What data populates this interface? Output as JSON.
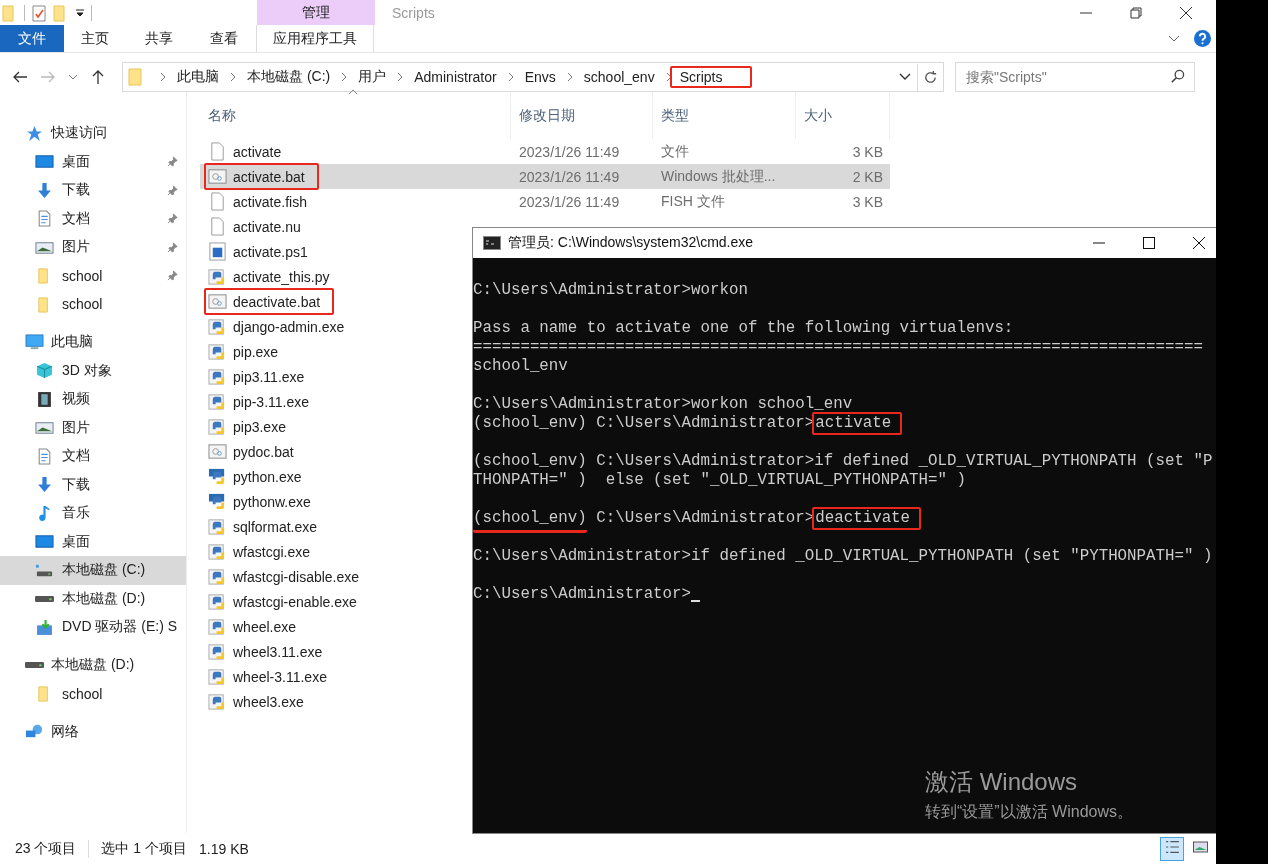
{
  "window": {
    "title": "Scripts"
  },
  "ribbon": {
    "context_group": "管理",
    "tabs": [
      {
        "label": "文件",
        "kind": "file"
      },
      {
        "label": "主页",
        "kind": "tab"
      },
      {
        "label": "共享",
        "kind": "tab"
      },
      {
        "label": "查看",
        "kind": "tab"
      },
      {
        "label": "应用程序工具",
        "kind": "context"
      }
    ]
  },
  "address_bar": {
    "crumbs": [
      {
        "label": "此电脑",
        "highlighted": false
      },
      {
        "label": "本地磁盘 (C:)",
        "highlighted": false
      },
      {
        "label": "用户",
        "highlighted": false
      },
      {
        "label": "Administrator",
        "highlighted": false
      },
      {
        "label": "Envs",
        "highlighted": false
      },
      {
        "label": "school_env",
        "highlighted": false
      },
      {
        "label": "Scripts",
        "highlighted": true
      }
    ]
  },
  "search": {
    "placeholder": "搜索\"Scripts\""
  },
  "sidebar": {
    "items": [
      {
        "label": "快速访问",
        "kind": "star",
        "selected": false,
        "children": [
          {
            "label": "桌面",
            "kind": "desktop",
            "pinned": true,
            "selected": false
          },
          {
            "label": "下载",
            "kind": "download",
            "pinned": true,
            "selected": false
          },
          {
            "label": "文档",
            "kind": "document",
            "pinned": true,
            "selected": false
          },
          {
            "label": "图片",
            "kind": "picture",
            "pinned": true,
            "selected": false
          },
          {
            "label": "school",
            "kind": "folder",
            "pinned": true,
            "selected": false
          },
          {
            "label": "school",
            "kind": "folder",
            "pinned": false,
            "selected": false
          }
        ]
      },
      {
        "label": "此电脑",
        "kind": "pc",
        "selected": false,
        "children": [
          {
            "label": "3D 对象",
            "kind": "cube",
            "pinned": false,
            "selected": false
          },
          {
            "label": "视频",
            "kind": "video",
            "pinned": false,
            "selected": false
          },
          {
            "label": "图片",
            "kind": "picture",
            "pinned": false,
            "selected": false
          },
          {
            "label": "文档",
            "kind": "document",
            "pinned": false,
            "selected": false
          },
          {
            "label": "下载",
            "kind": "download",
            "pinned": false,
            "selected": false
          },
          {
            "label": "音乐",
            "kind": "music",
            "pinned": false,
            "selected": false
          },
          {
            "label": "桌面",
            "kind": "desktop",
            "pinned": false,
            "selected": false
          },
          {
            "label": "本地磁盘 (C:)",
            "kind": "system-drive",
            "pinned": false,
            "selected": true
          },
          {
            "label": "本地磁盘 (D:)",
            "kind": "drive",
            "pinned": false,
            "selected": false
          },
          {
            "label": "DVD 驱动器 (E:) S",
            "kind": "dvd",
            "pinned": false,
            "selected": false
          }
        ]
      },
      {
        "label": "本地磁盘 (D:)",
        "kind": "drive",
        "selected": false,
        "children": [
          {
            "label": "school",
            "kind": "folder",
            "pinned": false,
            "selected": false
          }
        ]
      },
      {
        "label": "网络",
        "kind": "network",
        "selected": false
      }
    ]
  },
  "table": {
    "columns": [
      {
        "label": "名称",
        "sorted": true
      },
      {
        "label": "修改日期",
        "sorted": false
      },
      {
        "label": "类型",
        "sorted": false
      },
      {
        "label": "大小",
        "sorted": false
      }
    ],
    "rows": [
      {
        "name": "activate",
        "kind": "blank",
        "selected": false,
        "highlighted": false,
        "date": "2023/1/26 11:49",
        "type": "文件",
        "size": "3 KB"
      },
      {
        "name": "activate.bat",
        "kind": "bat",
        "selected": true,
        "highlighted": true,
        "date": "2023/1/26 11:49",
        "type": "Windows 批处理...",
        "size": "2 KB"
      },
      {
        "name": "activate.fish",
        "kind": "blank",
        "selected": false,
        "highlighted": false,
        "date": "2023/1/26 11:49",
        "type": "FISH 文件",
        "size": "3 KB"
      },
      {
        "name": "activate.nu",
        "kind": "blank",
        "selected": false,
        "highlighted": false
      },
      {
        "name": "activate.ps1",
        "kind": "ps1",
        "selected": false,
        "highlighted": false
      },
      {
        "name": "activate_this.py",
        "kind": "py",
        "selected": false,
        "highlighted": false
      },
      {
        "name": "deactivate.bat",
        "kind": "bat",
        "selected": false,
        "highlighted": true
      },
      {
        "name": "django-admin.exe",
        "kind": "exe",
        "selected": false,
        "highlighted": false
      },
      {
        "name": "pip.exe",
        "kind": "exe",
        "selected": false,
        "highlighted": false
      },
      {
        "name": "pip3.11.exe",
        "kind": "exe",
        "selected": false,
        "highlighted": false
      },
      {
        "name": "pip-3.11.exe",
        "kind": "exe",
        "selected": false,
        "highlighted": false
      },
      {
        "name": "pip3.exe",
        "kind": "exe",
        "selected": false,
        "highlighted": false
      },
      {
        "name": "pydoc.bat",
        "kind": "bat",
        "selected": false,
        "highlighted": false
      },
      {
        "name": "python.exe",
        "kind": "app",
        "selected": false,
        "highlighted": false
      },
      {
        "name": "pythonw.exe",
        "kind": "app",
        "selected": false,
        "highlighted": false
      },
      {
        "name": "sqlformat.exe",
        "kind": "exe",
        "selected": false,
        "highlighted": false
      },
      {
        "name": "wfastcgi.exe",
        "kind": "exe",
        "selected": false,
        "highlighted": false
      },
      {
        "name": "wfastcgi-disable.exe",
        "kind": "exe",
        "selected": false,
        "highlighted": false
      },
      {
        "name": "wfastcgi-enable.exe",
        "kind": "exe",
        "selected": false,
        "highlighted": false
      },
      {
        "name": "wheel.exe",
        "kind": "exe",
        "selected": false,
        "highlighted": false
      },
      {
        "name": "wheel3.11.exe",
        "kind": "exe",
        "selected": false,
        "highlighted": false
      },
      {
        "name": "wheel-3.11.exe",
        "kind": "exe",
        "selected": false,
        "highlighted": false
      },
      {
        "name": "wheel3.exe",
        "kind": "exe",
        "selected": false,
        "highlighted": false
      }
    ]
  },
  "terminal": {
    "title": "管理员: C:\\Windows\\system32\\cmd.exe",
    "lines": [
      {
        "kind": "text",
        "segments": [
          {
            "text": "C:\\Users\\Administrator>workon",
            "kind": "plain"
          }
        ]
      },
      {
        "kind": "blank"
      },
      {
        "kind": "text",
        "segments": [
          {
            "text": "Pass a name to activate one of the following virtualenvs:",
            "kind": "plain"
          }
        ]
      },
      {
        "kind": "text",
        "segments": [
          {
            "text": "=============================================================================",
            "kind": "plain"
          }
        ]
      },
      {
        "kind": "text",
        "segments": [
          {
            "text": "school_env",
            "kind": "plain"
          }
        ]
      },
      {
        "kind": "blank"
      },
      {
        "kind": "text",
        "segments": [
          {
            "text": "C:\\Users\\Administrator>workon school_env",
            "kind": "plain"
          }
        ]
      },
      {
        "kind": "text",
        "segments": [
          {
            "text": "(school_env) C:\\Users\\Administrator>",
            "kind": "plain"
          },
          {
            "text": "activate",
            "kind": "boxed"
          }
        ]
      },
      {
        "kind": "blank"
      },
      {
        "kind": "text",
        "segments": [
          {
            "text": "(school_env) C:\\Users\\Administrator>if defined _OLD_VIRTUAL_PYTHONPATH (set \"P",
            "kind": "plain"
          }
        ]
      },
      {
        "kind": "text",
        "segments": [
          {
            "text": "THONPATH=\" )  else (set \"_OLD_VIRTUAL_PYTHONPATH=\" )",
            "kind": "plain"
          }
        ]
      },
      {
        "kind": "blank"
      },
      {
        "kind": "text",
        "segments": [
          {
            "text": "(school_env)",
            "kind": "underlined"
          },
          {
            "text": " C:\\Users\\Administrator>",
            "kind": "plain"
          },
          {
            "text": "deactivate",
            "kind": "boxed"
          }
        ]
      },
      {
        "kind": "blank"
      },
      {
        "kind": "text",
        "segments": [
          {
            "text": "C:\\Users\\Administrator>if defined _OLD_VIRTUAL_PYTHONPATH (set \"PYTHONPATH=\" )",
            "kind": "plain"
          }
        ]
      },
      {
        "kind": "blank"
      },
      {
        "kind": "text",
        "cursor": true,
        "segments": [
          {
            "text": "C:\\Users\\Administrator>",
            "kind": "plain"
          }
        ]
      }
    ]
  },
  "watermark": {
    "title": "激活 Windows",
    "text": "转到“设置”以激活 Windows。"
  },
  "status_bar": {
    "item_count": "23 个项目",
    "selection": "选中 1 个项目",
    "selection_size": "1.19 KB",
    "views": [
      {
        "kind": "details",
        "selected": true
      },
      {
        "kind": "thumbnails",
        "selected": false
      }
    ]
  }
}
